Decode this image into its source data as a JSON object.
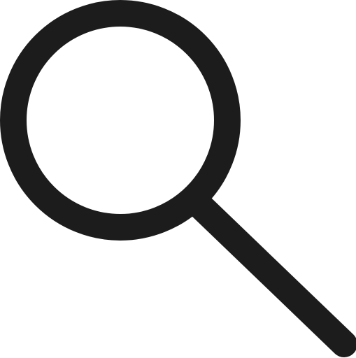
{
  "icon": {
    "name": "search-icon",
    "color": "#1c1c1c",
    "background": "#ffffff"
  }
}
